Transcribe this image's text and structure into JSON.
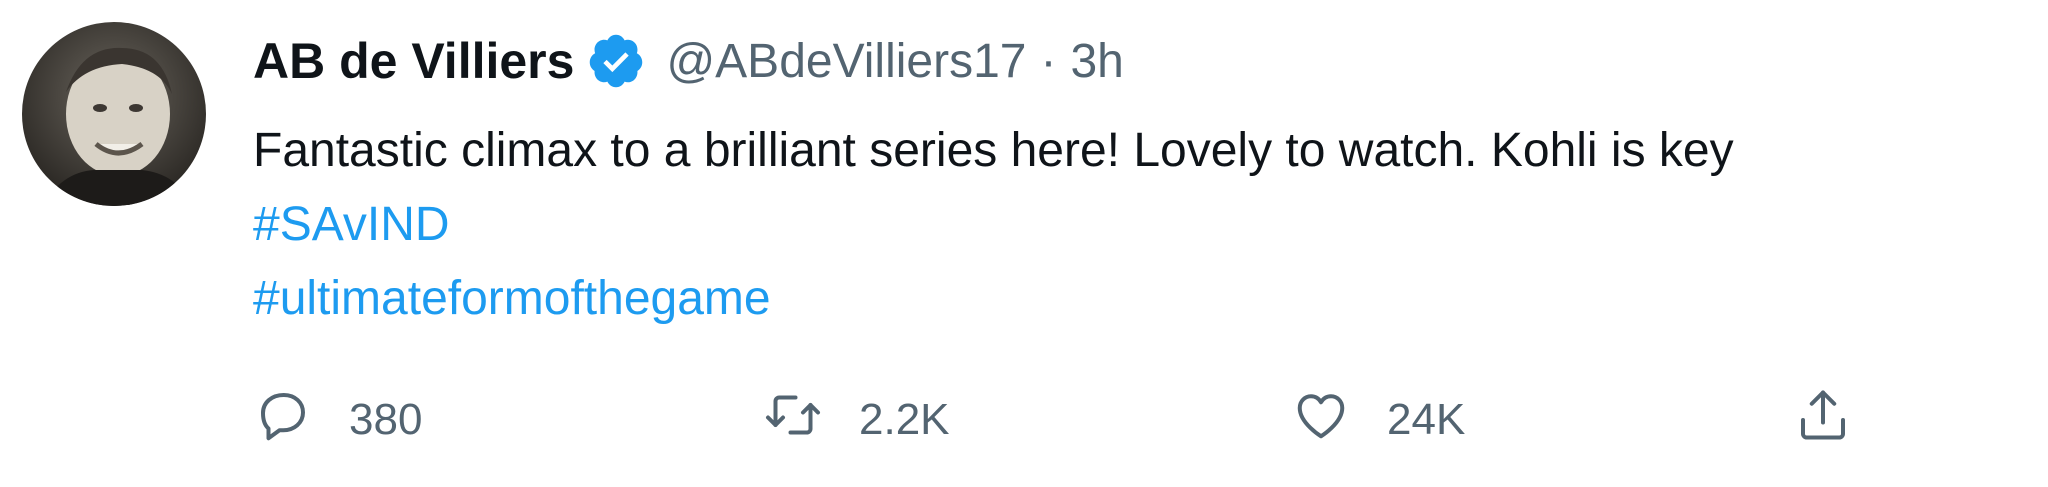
{
  "tweet": {
    "display_name": "AB de Villiers",
    "handle": "@ABdeVilliers17",
    "separator": "·",
    "time": "3h",
    "text": "Fantastic climax to a brilliant series here! Lovely to watch. Kohli is key",
    "hashtags": [
      "#SAvIND",
      "#ultimateformofthegame"
    ],
    "verified": true
  },
  "actions": {
    "reply_count": "380",
    "retweet_count": "2.2K",
    "like_count": "24K"
  },
  "colors": {
    "link": "#1d9bf0",
    "secondary_text": "#536471",
    "primary_text": "#0f1419"
  },
  "icons": {
    "reply": "reply-icon",
    "retweet": "retweet-icon",
    "like": "heart-icon",
    "share": "share-icon",
    "verified": "verified-badge-icon"
  }
}
